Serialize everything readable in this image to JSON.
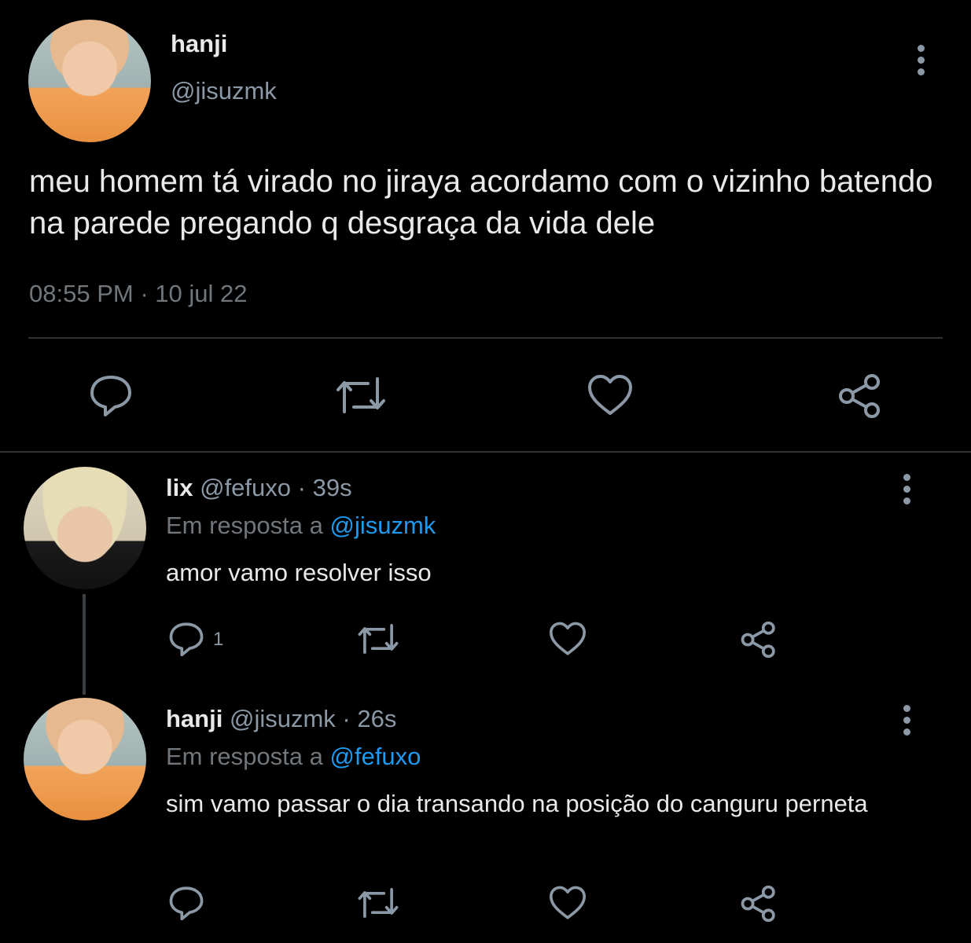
{
  "main_tweet": {
    "display_name": "hanji",
    "handle": "@jisuzmk",
    "text": "meu homem tá virado no jiraya acordamo com o vizinho batendo na parede pregando q desgraça da vida dele",
    "time": "08:55 PM",
    "separator": "·",
    "date": "10 jul 22"
  },
  "replies": [
    {
      "display_name": "lix",
      "handle": "@fefuxo",
      "separator": "·",
      "time": "39s",
      "reply_prefix": "Em resposta a",
      "reply_to": "@jisuzmk",
      "text": "amor vamo resolver isso",
      "reply_count": "1"
    },
    {
      "display_name": "hanji",
      "handle": "@jisuzmk",
      "separator": "·",
      "time": "26s",
      "reply_prefix": "Em resposta a",
      "reply_to": "@fefuxo",
      "text": "sim vamo passar o dia transando na posição do canguru perneta"
    }
  ],
  "icons": [
    "reply-icon",
    "retweet-icon",
    "like-icon",
    "share-icon",
    "more-icon"
  ],
  "colors": {
    "background": "#000000",
    "text": "#e7e9ea",
    "muted": "#8b98a5",
    "link": "#1d9bf0",
    "divider": "#2f3336"
  }
}
